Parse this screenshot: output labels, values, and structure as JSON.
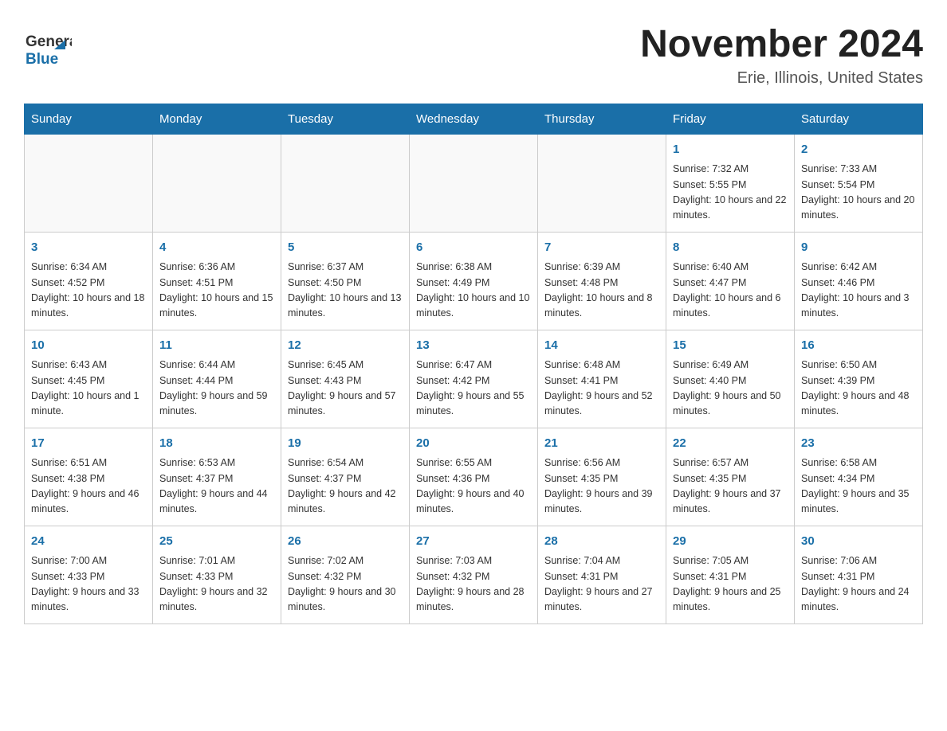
{
  "header": {
    "logo_general": "General",
    "logo_blue": "Blue",
    "month_title": "November 2024",
    "location": "Erie, Illinois, United States"
  },
  "days_of_week": [
    "Sunday",
    "Monday",
    "Tuesday",
    "Wednesday",
    "Thursday",
    "Friday",
    "Saturday"
  ],
  "weeks": [
    [
      {
        "day": "",
        "info": ""
      },
      {
        "day": "",
        "info": ""
      },
      {
        "day": "",
        "info": ""
      },
      {
        "day": "",
        "info": ""
      },
      {
        "day": "",
        "info": ""
      },
      {
        "day": "1",
        "info": "Sunrise: 7:32 AM\nSunset: 5:55 PM\nDaylight: 10 hours and 22 minutes."
      },
      {
        "day": "2",
        "info": "Sunrise: 7:33 AM\nSunset: 5:54 PM\nDaylight: 10 hours and 20 minutes."
      }
    ],
    [
      {
        "day": "3",
        "info": "Sunrise: 6:34 AM\nSunset: 4:52 PM\nDaylight: 10 hours and 18 minutes."
      },
      {
        "day": "4",
        "info": "Sunrise: 6:36 AM\nSunset: 4:51 PM\nDaylight: 10 hours and 15 minutes."
      },
      {
        "day": "5",
        "info": "Sunrise: 6:37 AM\nSunset: 4:50 PM\nDaylight: 10 hours and 13 minutes."
      },
      {
        "day": "6",
        "info": "Sunrise: 6:38 AM\nSunset: 4:49 PM\nDaylight: 10 hours and 10 minutes."
      },
      {
        "day": "7",
        "info": "Sunrise: 6:39 AM\nSunset: 4:48 PM\nDaylight: 10 hours and 8 minutes."
      },
      {
        "day": "8",
        "info": "Sunrise: 6:40 AM\nSunset: 4:47 PM\nDaylight: 10 hours and 6 minutes."
      },
      {
        "day": "9",
        "info": "Sunrise: 6:42 AM\nSunset: 4:46 PM\nDaylight: 10 hours and 3 minutes."
      }
    ],
    [
      {
        "day": "10",
        "info": "Sunrise: 6:43 AM\nSunset: 4:45 PM\nDaylight: 10 hours and 1 minute."
      },
      {
        "day": "11",
        "info": "Sunrise: 6:44 AM\nSunset: 4:44 PM\nDaylight: 9 hours and 59 minutes."
      },
      {
        "day": "12",
        "info": "Sunrise: 6:45 AM\nSunset: 4:43 PM\nDaylight: 9 hours and 57 minutes."
      },
      {
        "day": "13",
        "info": "Sunrise: 6:47 AM\nSunset: 4:42 PM\nDaylight: 9 hours and 55 minutes."
      },
      {
        "day": "14",
        "info": "Sunrise: 6:48 AM\nSunset: 4:41 PM\nDaylight: 9 hours and 52 minutes."
      },
      {
        "day": "15",
        "info": "Sunrise: 6:49 AM\nSunset: 4:40 PM\nDaylight: 9 hours and 50 minutes."
      },
      {
        "day": "16",
        "info": "Sunrise: 6:50 AM\nSunset: 4:39 PM\nDaylight: 9 hours and 48 minutes."
      }
    ],
    [
      {
        "day": "17",
        "info": "Sunrise: 6:51 AM\nSunset: 4:38 PM\nDaylight: 9 hours and 46 minutes."
      },
      {
        "day": "18",
        "info": "Sunrise: 6:53 AM\nSunset: 4:37 PM\nDaylight: 9 hours and 44 minutes."
      },
      {
        "day": "19",
        "info": "Sunrise: 6:54 AM\nSunset: 4:37 PM\nDaylight: 9 hours and 42 minutes."
      },
      {
        "day": "20",
        "info": "Sunrise: 6:55 AM\nSunset: 4:36 PM\nDaylight: 9 hours and 40 minutes."
      },
      {
        "day": "21",
        "info": "Sunrise: 6:56 AM\nSunset: 4:35 PM\nDaylight: 9 hours and 39 minutes."
      },
      {
        "day": "22",
        "info": "Sunrise: 6:57 AM\nSunset: 4:35 PM\nDaylight: 9 hours and 37 minutes."
      },
      {
        "day": "23",
        "info": "Sunrise: 6:58 AM\nSunset: 4:34 PM\nDaylight: 9 hours and 35 minutes."
      }
    ],
    [
      {
        "day": "24",
        "info": "Sunrise: 7:00 AM\nSunset: 4:33 PM\nDaylight: 9 hours and 33 minutes."
      },
      {
        "day": "25",
        "info": "Sunrise: 7:01 AM\nSunset: 4:33 PM\nDaylight: 9 hours and 32 minutes."
      },
      {
        "day": "26",
        "info": "Sunrise: 7:02 AM\nSunset: 4:32 PM\nDaylight: 9 hours and 30 minutes."
      },
      {
        "day": "27",
        "info": "Sunrise: 7:03 AM\nSunset: 4:32 PM\nDaylight: 9 hours and 28 minutes."
      },
      {
        "day": "28",
        "info": "Sunrise: 7:04 AM\nSunset: 4:31 PM\nDaylight: 9 hours and 27 minutes."
      },
      {
        "day": "29",
        "info": "Sunrise: 7:05 AM\nSunset: 4:31 PM\nDaylight: 9 hours and 25 minutes."
      },
      {
        "day": "30",
        "info": "Sunrise: 7:06 AM\nSunset: 4:31 PM\nDaylight: 9 hours and 24 minutes."
      }
    ]
  ]
}
